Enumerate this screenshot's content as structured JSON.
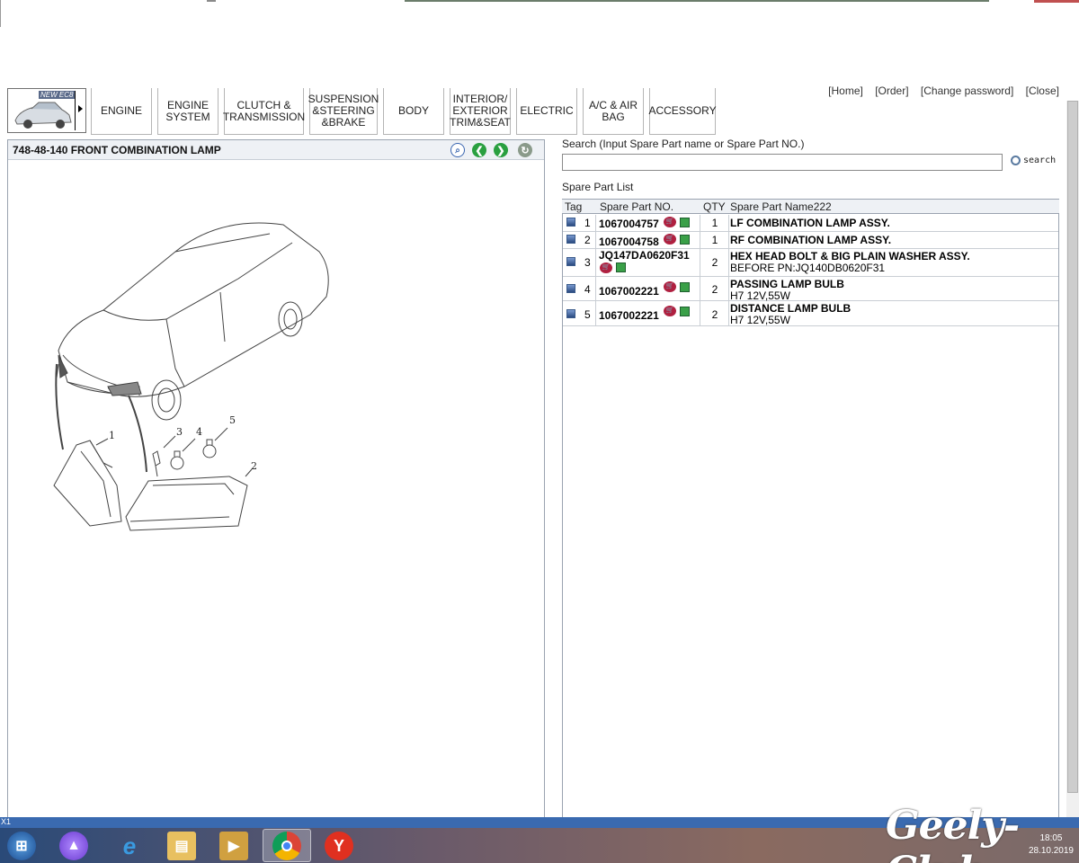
{
  "nav": {
    "thumb_badge": "NEW EC8",
    "items": [
      {
        "label": "ENGINE"
      },
      {
        "label": "ENGINE\nSYSTEM"
      },
      {
        "label": "CLUTCH &\nTRANSMISSION"
      },
      {
        "label": "SUSPENSION\n&STEERING\n&BRAKE"
      },
      {
        "label": "BODY"
      },
      {
        "label": "INTERIOR/\nEXTERIOR\nTRIM&SEAT"
      },
      {
        "label": "ELECTRIC"
      },
      {
        "label": "A/C & AIR\nBAG"
      },
      {
        "label": "ACCESSORY"
      }
    ],
    "links": [
      "[Home]",
      "[Order]",
      "[Change password]",
      "[Close]"
    ]
  },
  "left_panel": {
    "title": "748-48-140  FRONT COMBINATION LAMP",
    "tools": [
      "zoom-icon",
      "back-icon",
      "forward-icon",
      "refresh-icon"
    ],
    "diagram_labels": [
      "1",
      "2",
      "3",
      "4",
      "5"
    ]
  },
  "search": {
    "label": "Search (Input Spare Part name or Spare Part NO.)",
    "value": "",
    "button_label": "search"
  },
  "parts": {
    "label": "Spare Part List",
    "columns": [
      "Tag",
      "Spare Part NO.",
      "QTY",
      "Spare Part Name222"
    ],
    "rows": [
      {
        "num": "1",
        "part_no": "1067004757",
        "qty": "1",
        "name": "LF COMBINATION LAMP ASSY.",
        "sub": ""
      },
      {
        "num": "2",
        "part_no": "1067004758",
        "qty": "1",
        "name": "RF COMBINATION LAMP ASSY.",
        "sub": ""
      },
      {
        "num": "3",
        "part_no": "JQ147DA0620F31",
        "qty": "2",
        "name": "HEX HEAD BOLT & BIG PLAIN WASHER ASSY.",
        "sub": "BEFORE PN:JQ140DB0620F31"
      },
      {
        "num": "4",
        "part_no": "1067002221",
        "qty": "2",
        "name": "PASSING LAMP BULB",
        "sub": "H7 12V,55W"
      },
      {
        "num": "5",
        "part_no": "1067002221",
        "qty": "2",
        "name": "DISTANCE LAMP BULB",
        "sub": "H7 12V,55W"
      }
    ]
  },
  "status": {
    "text": "X1"
  },
  "taskbar": {
    "icons": [
      "start-icon",
      "alice-icon",
      "ie-icon",
      "explorer-icon",
      "media-player-icon",
      "chrome-icon",
      "yandex-icon"
    ],
    "time": "18:05",
    "date": "28.10.2019"
  },
  "watermark": "Geely-Club"
}
